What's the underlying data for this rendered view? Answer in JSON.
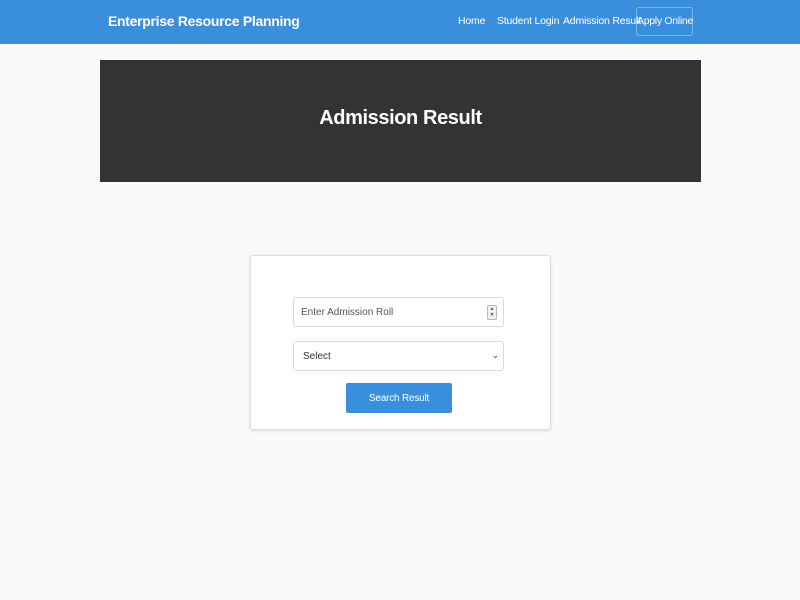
{
  "navbar": {
    "brand": "Enterprise Resource Planning",
    "links": [
      "Home",
      "Student Login",
      "Admission Result"
    ],
    "apply_button": "Apply Online",
    "background": "#3a8fdc"
  },
  "banner": {
    "title": "Admission Result",
    "background": "#333333"
  },
  "form": {
    "roll_placeholder": "Enter Admission Roll",
    "roll_value": "",
    "select_value": "Select",
    "search_button": "Search Result"
  },
  "icons": {
    "spinner": "number-spinner-icon",
    "chevron": "chevron-down-icon"
  }
}
